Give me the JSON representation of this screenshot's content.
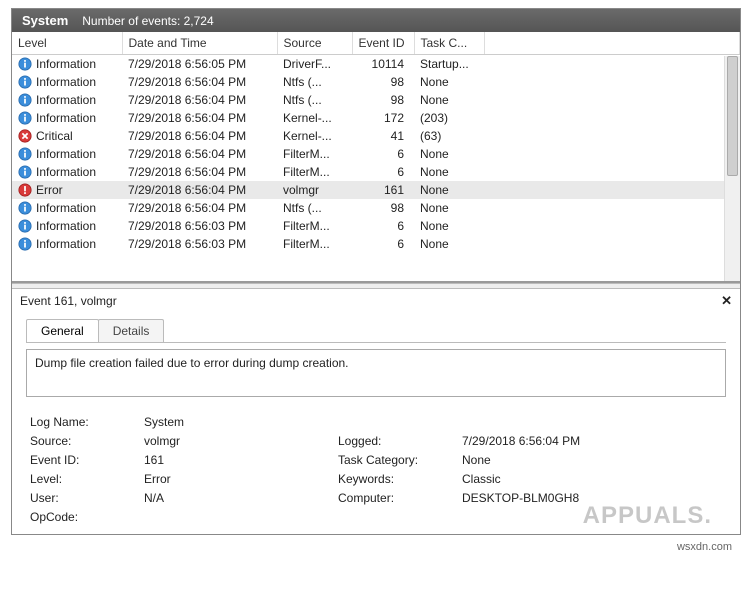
{
  "titlebar": {
    "title": "System",
    "subtitle": "Number of events: 2,724"
  },
  "columns": {
    "level": "Level",
    "datetime": "Date and Time",
    "source": "Source",
    "eventid": "Event ID",
    "taskc": "Task C..."
  },
  "rows": [
    {
      "icon": "info",
      "level": "Information",
      "dt": "7/29/2018 6:56:05 PM",
      "src": "DriverF...",
      "eid": "10114",
      "task": "Startup..."
    },
    {
      "icon": "info",
      "level": "Information",
      "dt": "7/29/2018 6:56:04 PM",
      "src": "Ntfs (...",
      "eid": "98",
      "task": "None"
    },
    {
      "icon": "info",
      "level": "Information",
      "dt": "7/29/2018 6:56:04 PM",
      "src": "Ntfs (...",
      "eid": "98",
      "task": "None"
    },
    {
      "icon": "info",
      "level": "Information",
      "dt": "7/29/2018 6:56:04 PM",
      "src": "Kernel-...",
      "eid": "172",
      "task": "(203)"
    },
    {
      "icon": "crit",
      "level": "Critical",
      "dt": "7/29/2018 6:56:04 PM",
      "src": "Kernel-...",
      "eid": "41",
      "task": "(63)"
    },
    {
      "icon": "info",
      "level": "Information",
      "dt": "7/29/2018 6:56:04 PM",
      "src": "FilterM...",
      "eid": "6",
      "task": "None"
    },
    {
      "icon": "info",
      "level": "Information",
      "dt": "7/29/2018 6:56:04 PM",
      "src": "FilterM...",
      "eid": "6",
      "task": "None"
    },
    {
      "icon": "err",
      "level": "Error",
      "dt": "7/29/2018 6:56:04 PM",
      "src": "volmgr",
      "eid": "161",
      "task": "None",
      "sel": true
    },
    {
      "icon": "info",
      "level": "Information",
      "dt": "7/29/2018 6:56:04 PM",
      "src": "Ntfs (...",
      "eid": "98",
      "task": "None"
    },
    {
      "icon": "info",
      "level": "Information",
      "dt": "7/29/2018 6:56:03 PM",
      "src": "FilterM...",
      "eid": "6",
      "task": "None"
    },
    {
      "icon": "info",
      "level": "Information",
      "dt": "7/29/2018 6:56:03 PM",
      "src": "FilterM...",
      "eid": "6",
      "task": "None"
    }
  ],
  "detail": {
    "header": "Event 161, volmgr",
    "tabs": {
      "general": "General",
      "details": "Details"
    },
    "message": "Dump file creation failed due to error during dump creation.",
    "labels": {
      "logname": "Log Name:",
      "source": "Source:",
      "eventid": "Event ID:",
      "level": "Level:",
      "user": "User:",
      "opcode": "OpCode:",
      "logged": "Logged:",
      "taskcat": "Task Category:",
      "keywords": "Keywords:",
      "computer": "Computer:"
    },
    "values": {
      "logname": "System",
      "source": "volmgr",
      "eventid": "161",
      "level": "Error",
      "user": "N/A",
      "opcode": "",
      "logged": "7/29/2018 6:56:04 PM",
      "taskcat": "None",
      "keywords": "Classic",
      "computer": "DESKTOP-BLM0GH8"
    }
  },
  "brand": {
    "watermark": "APPUALS.",
    "url": "wsxdn.com"
  },
  "close": "✕"
}
